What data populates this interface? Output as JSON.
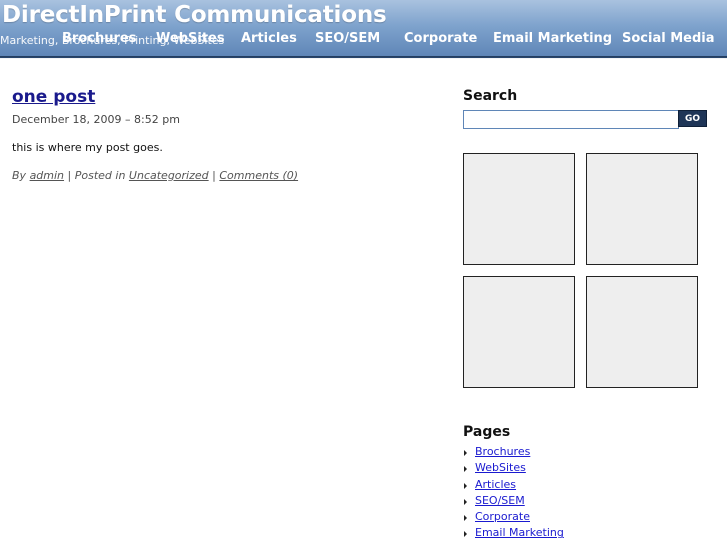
{
  "header": {
    "site_title": "DirectInPrint Communications",
    "tagline": "Marketing, Brochures, Printing, WebSites"
  },
  "nav": {
    "items": [
      {
        "label": "Brochures"
      },
      {
        "label": "WebSites"
      },
      {
        "label": "Articles"
      },
      {
        "label": "SEO/SEM"
      },
      {
        "label": "Corporate"
      },
      {
        "label": "Email Marketing"
      },
      {
        "label": "Social Media"
      }
    ]
  },
  "post": {
    "title": "one post",
    "date": "December 18, 2009 – 8:52 pm",
    "body": "this is where my post goes.",
    "meta_by": "By",
    "author": "admin",
    "meta_posted": "| Posted in",
    "category": "Uncategorized",
    "meta_sep": "|",
    "comments": "Comments (0)"
  },
  "sidebar": {
    "search_heading": "Search",
    "search_value": "",
    "go_label": "GO",
    "pages_heading": "Pages",
    "pages": [
      {
        "label": "Brochures"
      },
      {
        "label": "WebSites"
      },
      {
        "label": "Articles"
      },
      {
        "label": "SEO/SEM"
      },
      {
        "label": "Corporate"
      },
      {
        "label": "Email Marketing"
      }
    ]
  }
}
